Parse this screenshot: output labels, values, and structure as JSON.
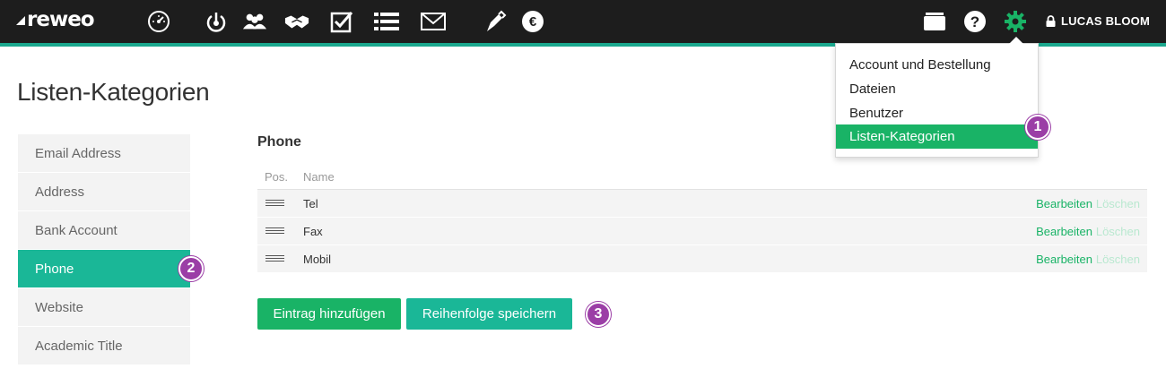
{
  "app": {
    "logo": "reweo"
  },
  "nav": {
    "icons": [
      "dashboard-icon",
      "power-icon",
      "contacts-icon",
      "handshake-icon",
      "tasks-icon",
      "list-icon",
      "mail-icon",
      "pen-icon",
      "euro-icon"
    ],
    "right_icons": [
      "archive-icon",
      "help-icon",
      "gear-icon",
      "lock-icon"
    ],
    "user_name": "LUCAS BLOOM"
  },
  "settings_menu": {
    "items": [
      {
        "label": "Account und Bestellung"
      },
      {
        "label": "Dateien"
      },
      {
        "label": "Benutzer"
      },
      {
        "label": "Listen-Kategorien"
      }
    ],
    "active_index": 3
  },
  "page": {
    "title": "Listen-Kategorien"
  },
  "sidebar": {
    "items": [
      {
        "label": "Email Address"
      },
      {
        "label": "Address"
      },
      {
        "label": "Bank Account"
      },
      {
        "label": "Phone"
      },
      {
        "label": "Website"
      },
      {
        "label": "Academic Title"
      }
    ],
    "active_index": 3
  },
  "main": {
    "section_title": "Phone",
    "columns": {
      "pos": "Pos.",
      "name": "Name"
    },
    "rows": [
      {
        "name": "Tel",
        "edit": "Bearbeiten",
        "delete": "Löschen"
      },
      {
        "name": "Fax",
        "edit": "Bearbeiten",
        "delete": "Löschen"
      },
      {
        "name": "Mobil",
        "edit": "Bearbeiten",
        "delete": "Löschen"
      }
    ],
    "add_button": "Eintrag hinzufügen",
    "save_order_button": "Reihenfolge speichern"
  },
  "badges": [
    "1",
    "2",
    "3"
  ],
  "colors": {
    "accent": "#1ab797",
    "green": "#19b366",
    "badge": "#9b3ea6",
    "topbar": "#1d1d1d"
  }
}
